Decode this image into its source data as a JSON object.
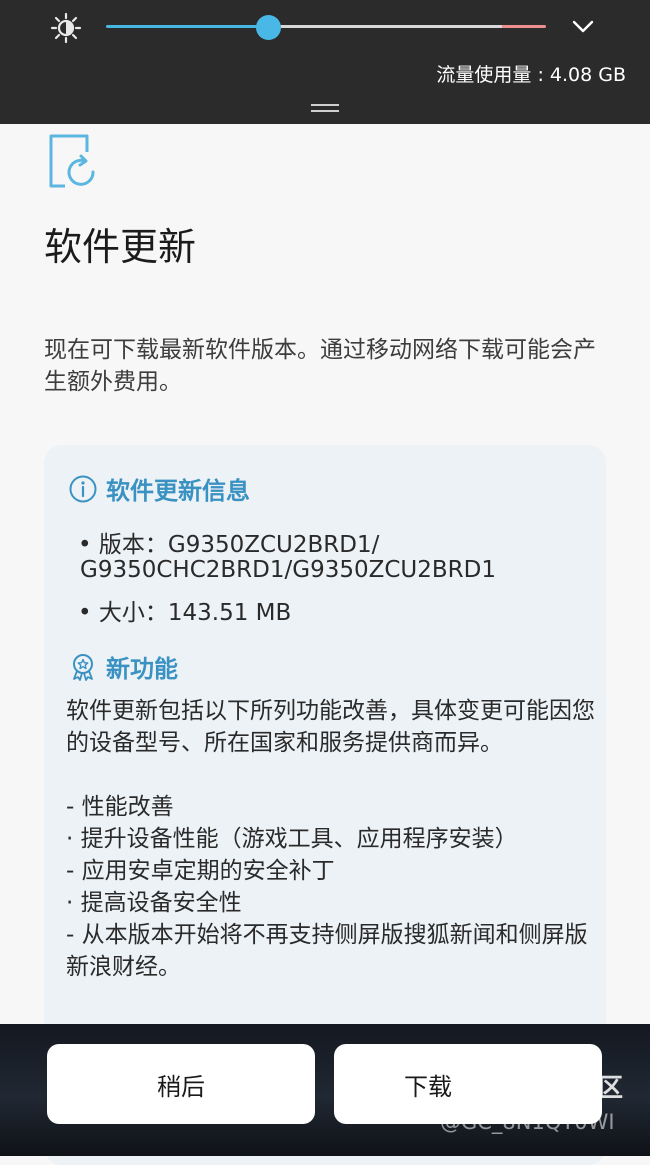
{
  "quick_panel": {
    "brightness_level": 0.37,
    "data_usage": "流量使用量 : 4.08 GB"
  },
  "page": {
    "title": "软件更新",
    "description": "现在可下载最新软件版本。通过移动网络下载可能会产生额外费用。"
  },
  "update_info": {
    "header": "软件更新信息",
    "version_line1": "• 版本：G9350ZCU2BRD1/",
    "version_line2": "G9350CHC2BRD1/G9350ZCU2BRD1",
    "size_line": "• 大小：143.51 MB"
  },
  "new_features": {
    "header": "新功能",
    "intro": "软件更新包括以下所列功能改善，具体变更可能因您的设备型号、所在国家和服务提供商而异。",
    "items": [
      "- 性能改善",
      " · 提升设备性能（游戏工具、应用程序安装）",
      "- 应用安卓定期的安全补丁",
      " · 提高设备安全性",
      "- 从本版本开始将不再支持侧屏版搜狐新闻和侧屏版新浪财经。"
    ]
  },
  "buttons": {
    "later": "稍后",
    "download": "下载"
  },
  "watermark": {
    "site": "盖乐世社区",
    "user": "@GC_8N1QT0WI"
  },
  "colors": {
    "accent": "#3a92c2",
    "slider": "#4ab8e6",
    "panel_bg": "#2b2b2b",
    "card_bg": "#edf2f6"
  }
}
